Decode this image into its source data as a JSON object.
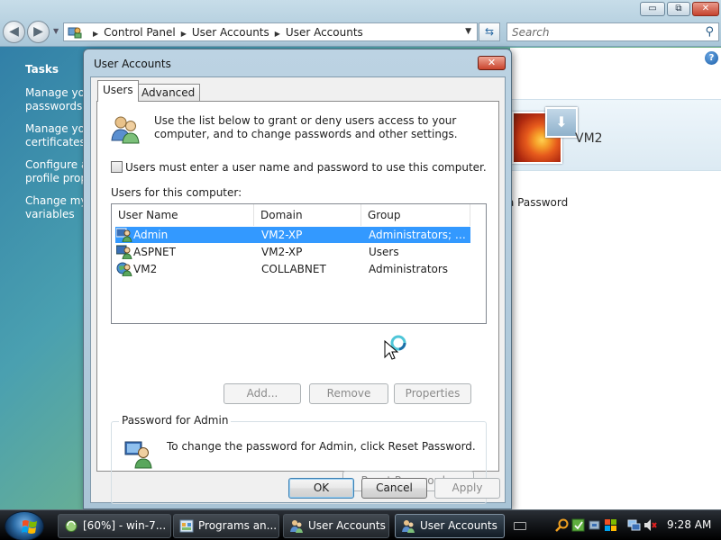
{
  "explorer": {
    "caption_buttons": {
      "minimize": "▭",
      "maximize": "⧉",
      "close": "✕"
    },
    "nav": {
      "back": "◀",
      "forward": "▶",
      "recent": "▼"
    },
    "breadcrumbs": [
      "Control Panel",
      "User Accounts",
      "User Accounts"
    ],
    "search_placeholder": "Search",
    "tasks": {
      "title": "Tasks",
      "links": [
        [
          "Manage your",
          "passwords"
        ],
        [
          "Manage your",
          "certificates"
        ],
        [
          "Configure advanced",
          "profile properties"
        ],
        [
          "Change my environment",
          "variables"
        ]
      ]
    },
    "user_name": "VM2",
    "password_link": "a Password",
    "help_label": "?"
  },
  "dialog": {
    "title": "User Accounts",
    "close": "✕",
    "tabs": [
      "Users",
      "Advanced"
    ],
    "intro": "Use the list below to grant or deny users access to your computer, and to change passwords and other settings.",
    "checkbox_label": "Users must enter a user name and password to use this computer.",
    "checkbox_checked": false,
    "users_label": "Users for this computer:",
    "columns": [
      "User Name",
      "Domain",
      "Group"
    ],
    "rows": [
      {
        "user": "Admin",
        "domain": "VM2-XP",
        "group": "Administrators; Us...",
        "selected": true
      },
      {
        "user": "ASPNET",
        "domain": "VM2-XP",
        "group": "Users",
        "selected": false
      },
      {
        "user": "VM2",
        "domain": "COLLABNET",
        "group": "Administrators",
        "selected": false
      }
    ],
    "buttons": {
      "add": "Add...",
      "remove": "Remove",
      "properties": "Properties"
    },
    "password_group": {
      "legend": "Password for Admin",
      "text": "To change the password for Admin, click Reset Password.",
      "reset": "Reset Password..."
    },
    "footer": {
      "ok": "OK",
      "cancel": "Cancel",
      "apply": "Apply"
    }
  },
  "taskbar": {
    "tasks": [
      {
        "label": "[60%] - win-7...",
        "icon": "sync-icon"
      },
      {
        "label": "Programs an...",
        "icon": "programs-icon"
      },
      {
        "label": "User Accounts",
        "icon": "users-icon"
      },
      {
        "label": "User Accounts",
        "icon": "users-icon",
        "active": true
      }
    ],
    "clock": "9:28 AM"
  }
}
